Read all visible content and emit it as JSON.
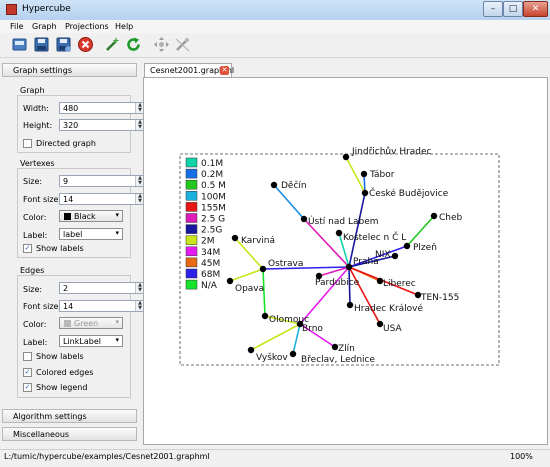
{
  "window": {
    "title": "Hypercube",
    "minimize": "–",
    "maximize": "□",
    "close": "✕"
  },
  "menu": [
    "File",
    "Graph",
    "Projections",
    "Help"
  ],
  "toolbar": [
    "new-icon",
    "save-icon",
    "save-as-icon",
    "close-file-icon",
    "magic-wand-icon",
    "reload-icon",
    "move-icon",
    "edit-disabled-icon"
  ],
  "panel": {
    "graph_settings": "Graph settings",
    "graph": {
      "title": "Graph",
      "width_label": "Width:",
      "width": "480",
      "height_label": "Height:",
      "height": "320",
      "directed_label": "Directed graph"
    },
    "vertexes": {
      "title": "Vertexes",
      "size_label": "Size:",
      "size": "9",
      "font_label": "Font size:",
      "font": "14",
      "color_label": "Color:",
      "color": "Black",
      "label_label": "Label:",
      "label": "label",
      "show_labels": "Show labels"
    },
    "edges": {
      "title": "Edges",
      "size_label": "Size:",
      "size": "2",
      "font_label": "Font size:",
      "font": "14",
      "color_label": "Color:",
      "color": "Green",
      "label_label": "Label:",
      "label": "LinkLabel",
      "show_labels": "Show labels",
      "colored": "Colored edges",
      "legend": "Show legend"
    },
    "algorithm": "Algorithm settings",
    "misc": "Miscellaneous"
  },
  "tab": {
    "label": "Cesnet2001.graphml"
  },
  "status": {
    "path": "L:/tumic/hypercube/examples/Cesnet2001.graphml",
    "zoom": "100%"
  },
  "legend": [
    {
      "label": "0.1M",
      "color": "#10d4a8"
    },
    {
      "label": "0.2M",
      "color": "#1570e8"
    },
    {
      "label": "0.5 M",
      "color": "#22c81e"
    },
    {
      "label": "100M",
      "color": "#1ab2dc"
    },
    {
      "label": "155M",
      "color": "#e81515"
    },
    {
      "label": "2.5 G",
      "color": "#de1ab8"
    },
    {
      "label": "2.5G",
      "color": "#17189e"
    },
    {
      "label": "2M",
      "color": "#c8e51a"
    },
    {
      "label": "34M",
      "color": "#e51af0"
    },
    {
      "label": "45M",
      "color": "#e86a12"
    },
    {
      "label": "68M",
      "color": "#2d20e8"
    },
    {
      "label": "N/A",
      "color": "#15e42a"
    }
  ],
  "nodes": [
    {
      "id": "jindrichuv",
      "label": "Jindřichův Hradec"
    },
    {
      "id": "tabor",
      "label": "Tábor"
    },
    {
      "id": "decin",
      "label": "Děčín"
    },
    {
      "id": "budejovice",
      "label": "České Budějovice"
    },
    {
      "id": "usti",
      "label": "Ústí nad Labem"
    },
    {
      "id": "cheb",
      "label": "Cheb"
    },
    {
      "id": "kostelec",
      "label": "Kostelec n Č L"
    },
    {
      "id": "karvina",
      "label": "Karviná"
    },
    {
      "id": "plzen",
      "label": "Plzeň"
    },
    {
      "id": "nix",
      "label": "NIX"
    },
    {
      "id": "ostrava",
      "label": "Ostrava"
    },
    {
      "id": "praha",
      "label": "Praha"
    },
    {
      "id": "pardubice",
      "label": "Pardubice"
    },
    {
      "id": "liberec",
      "label": "Liberec"
    },
    {
      "id": "opava",
      "label": "Opava"
    },
    {
      "id": "ten155",
      "label": "TEN-155"
    },
    {
      "id": "hradec",
      "label": "Hradec Králové"
    },
    {
      "id": "olomouc",
      "label": "Olomouc"
    },
    {
      "id": "usa",
      "label": "USA"
    },
    {
      "id": "brno",
      "label": "Brno"
    },
    {
      "id": "zlin",
      "label": "Zlín"
    },
    {
      "id": "vyskov",
      "label": "Vyškov"
    },
    {
      "id": "breclav",
      "label": "Břeclav, Lednice"
    }
  ]
}
